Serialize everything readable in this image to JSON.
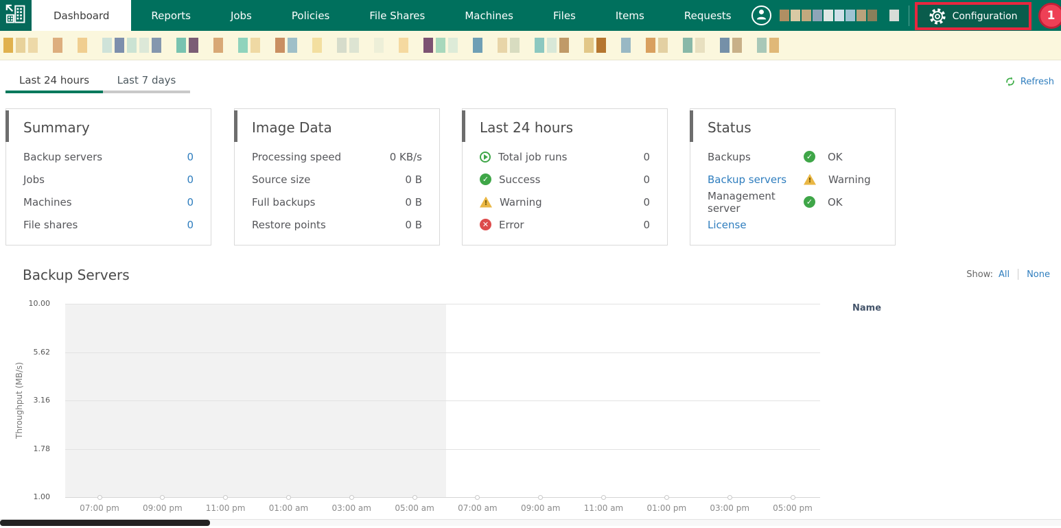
{
  "colors": {
    "brand_green": "#00705d",
    "brand_green_dark": "#0a5c4c",
    "highlight_red": "#e8273f",
    "badge_red": "#ee4056",
    "link_blue": "#2e7dbe",
    "success_green": "#3fa648",
    "warning_yellow": "#eab744",
    "error_red": "#dd4b4b",
    "banner_bg": "#fbf7dd",
    "active_tab_underline": "#00795c"
  },
  "nav": {
    "tabs": [
      {
        "label": "Dashboard",
        "active": true
      },
      {
        "label": "Reports",
        "active": false
      },
      {
        "label": "Jobs",
        "active": false
      },
      {
        "label": "Policies",
        "active": false
      },
      {
        "label": "File Shares",
        "active": false
      },
      {
        "label": "Machines",
        "active": false
      },
      {
        "label": "Files",
        "active": false
      },
      {
        "label": "Items",
        "active": false
      },
      {
        "label": "Requests",
        "active": false
      }
    ],
    "configuration_label": "Configuration",
    "badge_count": "1",
    "redacted_blocks": [
      "#b08f63",
      "#d9c9a4",
      "#c2a97e",
      "#8ea5b8",
      "#dfe8e4",
      "#cfe0e8",
      "#9ec3d2",
      "#b9a27c",
      "#8a7f5a",
      "",
      "#d8dcd8"
    ]
  },
  "banner_blocks": [
    "#e0b14d",
    "#e8d29a",
    "#edd9a8",
    "",
    "#ddae7e",
    "",
    "#f0ce90",
    "",
    "#cfe3d9",
    "#7d8fac",
    "#cbe3d3",
    "#dce8d8",
    "#8497ae",
    "",
    "#79c3b0",
    "#7b5d75",
    "",
    "#d8a876",
    "",
    "#8fd3bc",
    "#efd9a4",
    "",
    "#c98f62",
    "#9fbfc8",
    "",
    "#f3dfa0",
    "",
    "#d6dccb",
    "#dde4d2",
    "",
    "#edefd8",
    "",
    "#f5d9a0",
    "",
    "#7c5272",
    "#a8d8bc",
    "#ddebd8",
    "",
    "#6f9fb5",
    "",
    "#e8d5a8",
    "#d8dcc0",
    "",
    "#8cc8c0",
    "#d8e8d8",
    "#c09a68",
    "",
    "#e2c788",
    "#b5762f",
    "",
    "#99b8c4",
    "",
    "#d9a05f",
    "#e3d0a2",
    "",
    "#88b8a8",
    "#e8e0c0",
    "",
    "#7590a8",
    "#c8b088",
    "",
    "#a8c8b8",
    "#e0b878"
  ],
  "period_tabs": [
    {
      "label": "Last 24 hours",
      "active": true
    },
    {
      "label": "Last 7 days",
      "active": false
    }
  ],
  "refresh_label": "Refresh",
  "cards": [
    {
      "id": "summary",
      "title": "Summary",
      "rows": [
        {
          "label": "Backup servers",
          "value": "0",
          "value_link": true
        },
        {
          "label": "Jobs",
          "value": "0",
          "value_link": true
        },
        {
          "label": "Machines",
          "value": "0",
          "value_link": true
        },
        {
          "label": "File shares",
          "value": "0",
          "value_link": true
        }
      ]
    },
    {
      "id": "image-data",
      "title": "Image Data",
      "rows": [
        {
          "label": "Processing speed",
          "value": "0 KB/s"
        },
        {
          "label": "Source size",
          "value": "0 B"
        },
        {
          "label": "Full backups",
          "value": "0 B"
        },
        {
          "label": "Restore points",
          "value": "0 B"
        }
      ]
    },
    {
      "id": "last-24-hours",
      "title": "Last 24 hours",
      "rows": [
        {
          "icon": "play",
          "label": "Total job runs",
          "value": "0"
        },
        {
          "icon": "success",
          "label": "Success",
          "value": "0"
        },
        {
          "icon": "warning",
          "label": "Warning",
          "value": "0"
        },
        {
          "icon": "error",
          "label": "Error",
          "value": "0"
        }
      ]
    },
    {
      "id": "status",
      "title": "Status",
      "rows": [
        {
          "label": "Backups",
          "status_icon": "success",
          "status_text": "OK"
        },
        {
          "label": "Backup servers",
          "label_link": true,
          "status_icon": "warning",
          "status_text": "Warning"
        },
        {
          "label": "Management server",
          "status_icon": "success",
          "status_text": "OK"
        },
        {
          "label": "License",
          "label_link": true
        }
      ]
    }
  ],
  "backup_servers": {
    "title": "Backup Servers",
    "show_label": "Show:",
    "all_label": "All",
    "none_label": "None",
    "name_header": "Name"
  },
  "chart_data": {
    "type": "line",
    "title": "Backup Servers",
    "ylabel": "Throughput (MB/s)",
    "y_scale": "log",
    "ylim": [
      1,
      10
    ],
    "y_tick_labels": [
      "10.00",
      "5.62",
      "3.16",
      "1.78",
      "1.00"
    ],
    "x_tick_labels": [
      "07:00 pm",
      "09:00 pm",
      "11:00 pm",
      "01:00 am",
      "03:00 am",
      "05:00 am",
      "07:00 am",
      "09:00 am",
      "11:00 am",
      "01:00 pm",
      "03:00 pm",
      "05:00 pm"
    ],
    "series": [
      {
        "name": "throughput",
        "values": [
          1.0,
          1.0,
          1.0,
          1.0,
          1.0,
          1.0,
          1.0,
          1.0,
          1.0,
          1.0,
          1.0,
          1.0
        ]
      }
    ],
    "shaded_x_range": [
      "start",
      "06:00 am"
    ],
    "grid": true,
    "legend": "none"
  }
}
